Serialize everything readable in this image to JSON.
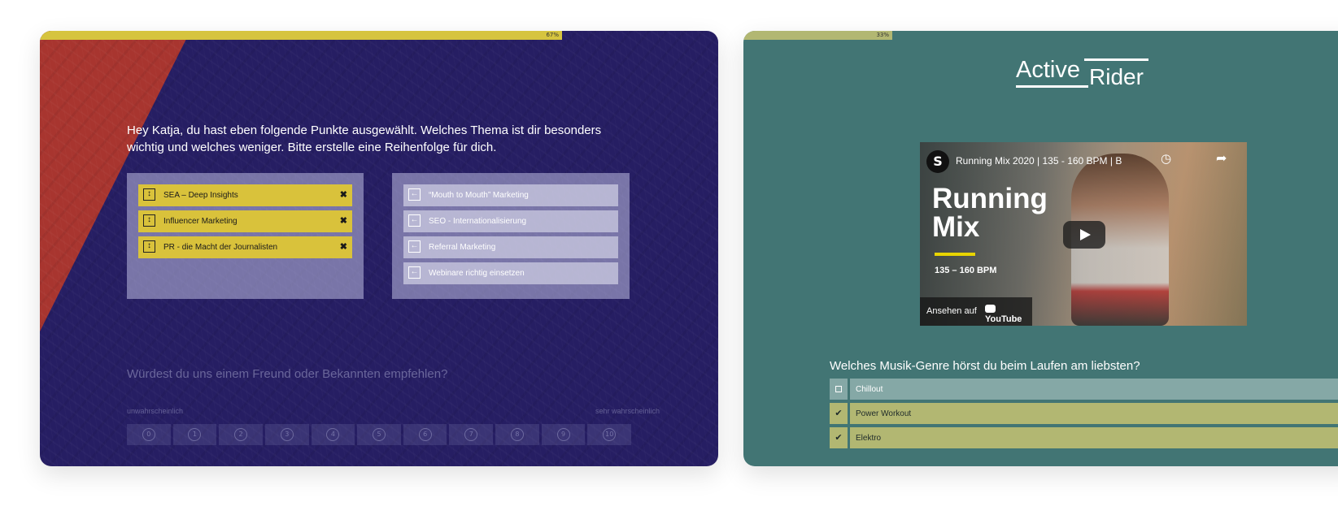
{
  "left_card": {
    "progress": {
      "fraction": 0.67,
      "label": "67%"
    },
    "question": "Hey Katja, du hast eben folgende Punkte ausgewählt. Welches Thema ist dir besonders wichtig und welches weniger. Bitte erstelle eine Reihenfolge für dich.",
    "selected_items": [
      {
        "label": "SEA – Deep Insights"
      },
      {
        "label": "Influencer Marketing"
      },
      {
        "label": "PR - die Macht der Journalisten"
      }
    ],
    "available_items": [
      {
        "label": "“Mouth to Mouth” Marketing"
      },
      {
        "label": "SEO - Internationalisierung"
      },
      {
        "label": "Referral Marketing"
      },
      {
        "label": "Webinare richtig einsetzen"
      }
    ],
    "next_question": "Würdest du uns einem Freund oder Bekannten empfehlen?",
    "scale_low_label": "unwahrscheinlich",
    "scale_high_label": "sehr wahrscheinlich",
    "scale": [
      "0",
      "1",
      "2",
      "3",
      "4",
      "5",
      "6",
      "7",
      "8",
      "9",
      "10"
    ],
    "colors": {
      "background": "#261e63",
      "accent": "#d9c23b",
      "wedge": "#a8352f"
    }
  },
  "right_card": {
    "progress": {
      "fraction": 0.33,
      "label": "33%"
    },
    "logo": {
      "word1": "Active",
      "word2": "Rider"
    },
    "video": {
      "channel_icon": "S",
      "title": "Running Mix 2020 | 135 - 160 BPM | B",
      "overlay_line1": "Running",
      "overlay_line2": "Mix",
      "overlay_bpm": "135 – 160 BPM",
      "watch_on": "Ansehen auf",
      "youtube": "YouTube"
    },
    "question": "Welches Musik-Genre hörst du beim Laufen am liebsten?",
    "options": [
      {
        "label": "Chillout",
        "checked": false
      },
      {
        "label": "Power Workout",
        "checked": true
      },
      {
        "label": "Elektro",
        "checked": true
      }
    ],
    "colors": {
      "background": "#427574",
      "accent": "#b2b772"
    }
  }
}
